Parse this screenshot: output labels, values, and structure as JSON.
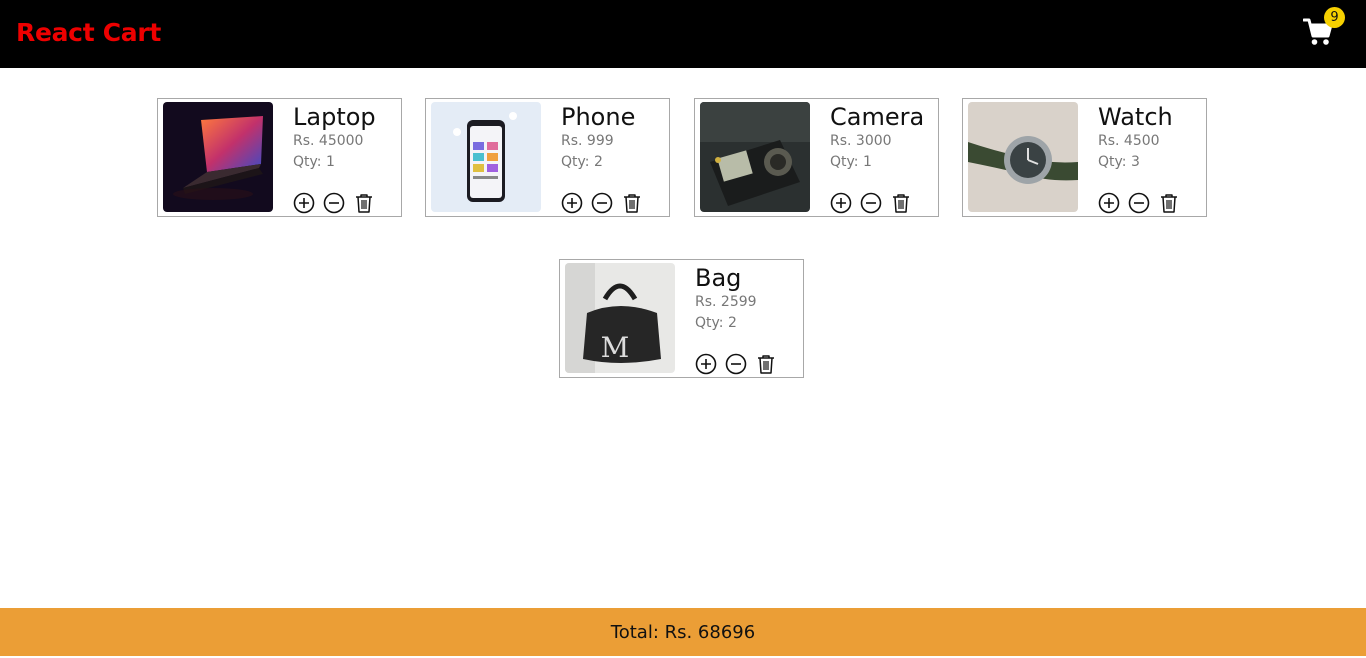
{
  "app": {
    "title": "React Cart",
    "cart_count": "9",
    "brand_color": "#ee0000",
    "badge_color": "#f6d000",
    "footer_color": "#eb9e36"
  },
  "products": [
    {
      "name": "Laptop",
      "price": "Rs. 45000",
      "qty": "Qty: 1",
      "image": "laptop-image"
    },
    {
      "name": "Phone",
      "price": "Rs. 999",
      "qty": "Qty: 2",
      "image": "phone-image"
    },
    {
      "name": "Camera",
      "price": "Rs. 3000",
      "qty": "Qty: 1",
      "image": "camera-image"
    },
    {
      "name": "Watch",
      "price": "Rs. 4500",
      "qty": "Qty: 3",
      "image": "watch-image"
    },
    {
      "name": "Bag",
      "price": "Rs. 2599",
      "qty": "Qty: 2",
      "image": "bag-image"
    }
  ],
  "icons": {
    "cart": "shopping-cart-icon",
    "increase": "plus-circle-icon",
    "decrease": "minus-circle-icon",
    "delete": "trash-icon"
  },
  "footer": {
    "total": "Total: Rs. 68696"
  }
}
